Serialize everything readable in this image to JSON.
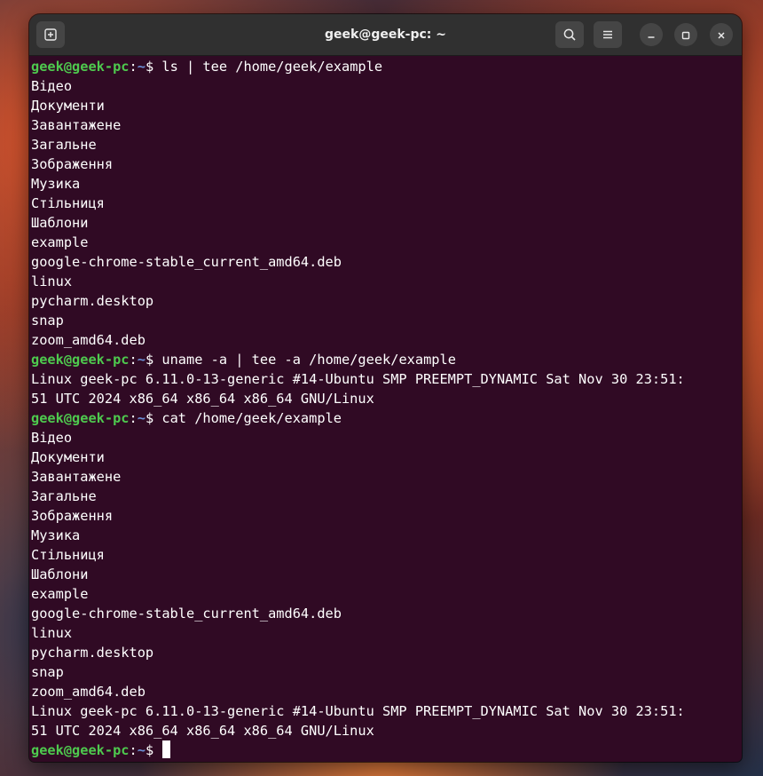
{
  "window": {
    "title": "geek@geek-pc: ~"
  },
  "icons": {
    "new_tab": "new-tab-icon",
    "search": "search-icon",
    "menu": "hamburger-menu-icon",
    "minimize": "minimize-icon",
    "maximize": "maximize-icon",
    "close": "close-icon"
  },
  "prompt": {
    "user_host": "geek@geek-pc",
    "colon": ":",
    "path": "~",
    "dollar": "$ "
  },
  "lines": [
    {
      "type": "prompt",
      "cmd": "ls | tee /home/geek/example"
    },
    {
      "type": "out",
      "text": "Відео"
    },
    {
      "type": "out",
      "text": "Документи"
    },
    {
      "type": "out",
      "text": "Завантажене"
    },
    {
      "type": "out",
      "text": "Загальне"
    },
    {
      "type": "out",
      "text": "Зображення"
    },
    {
      "type": "out",
      "text": "Музика"
    },
    {
      "type": "out",
      "text": "Стільниця"
    },
    {
      "type": "out",
      "text": "Шаблони"
    },
    {
      "type": "out",
      "text": "example"
    },
    {
      "type": "out",
      "text": "google-chrome-stable_current_amd64.deb"
    },
    {
      "type": "out",
      "text": "linux"
    },
    {
      "type": "out",
      "text": "pycharm.desktop"
    },
    {
      "type": "out",
      "text": "snap"
    },
    {
      "type": "out",
      "text": "zoom_amd64.deb"
    },
    {
      "type": "prompt",
      "cmd": "uname -a | tee -a /home/geek/example"
    },
    {
      "type": "out",
      "text": "Linux geek-pc 6.11.0-13-generic #14-Ubuntu SMP PREEMPT_DYNAMIC Sat Nov 30 23:51:"
    },
    {
      "type": "out",
      "text": "51 UTC 2024 x86_64 x86_64 x86_64 GNU/Linux"
    },
    {
      "type": "prompt",
      "cmd": "cat /home/geek/example"
    },
    {
      "type": "out",
      "text": "Відео"
    },
    {
      "type": "out",
      "text": "Документи"
    },
    {
      "type": "out",
      "text": "Завантажене"
    },
    {
      "type": "out",
      "text": "Загальне"
    },
    {
      "type": "out",
      "text": "Зображення"
    },
    {
      "type": "out",
      "text": "Музика"
    },
    {
      "type": "out",
      "text": "Стільниця"
    },
    {
      "type": "out",
      "text": "Шаблони"
    },
    {
      "type": "out",
      "text": "example"
    },
    {
      "type": "out",
      "text": "google-chrome-stable_current_amd64.deb"
    },
    {
      "type": "out",
      "text": "linux"
    },
    {
      "type": "out",
      "text": "pycharm.desktop"
    },
    {
      "type": "out",
      "text": "snap"
    },
    {
      "type": "out",
      "text": "zoom_amd64.deb"
    },
    {
      "type": "out",
      "text": "Linux geek-pc 6.11.0-13-generic #14-Ubuntu SMP PREEMPT_DYNAMIC Sat Nov 30 23:51:"
    },
    {
      "type": "out",
      "text": "51 UTC 2024 x86_64 x86_64 x86_64 GNU/Linux"
    },
    {
      "type": "prompt",
      "cmd": "",
      "cursor": true
    }
  ],
  "colors": {
    "terminal_bg": "#300a24",
    "user_host": "#4ec94e",
    "path": "#6b8fd6",
    "text": "#ffffff",
    "titlebar": "#303030"
  }
}
